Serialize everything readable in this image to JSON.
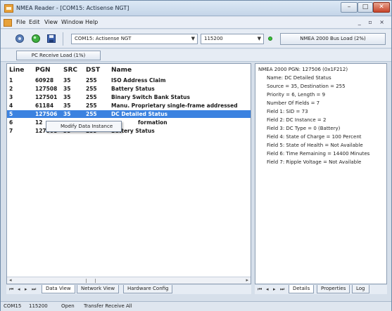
{
  "window": {
    "title": "NMEA Reader - [COM15: Actisense NGT]",
    "title_short": "NMEA Reader - [COM15: Actisense NGT]"
  },
  "menu": {
    "items": [
      "File",
      "Edit",
      "View",
      "Window",
      "Help"
    ],
    "mdi_controls": "_ ▫ ×"
  },
  "toolbar": {
    "port_value": "COM15: Actisense NGT",
    "baud_value": "115200",
    "bus_load_label": "NMEA 2000 Bus Load (2%)",
    "pc_load_label": "PC Receive Load (1%)"
  },
  "list": {
    "headers": {
      "line": "Line",
      "pgn": "PGN",
      "src": "SRC",
      "dst": "DST",
      "name": "Name"
    },
    "rows": [
      {
        "line": "1",
        "pgn": "60928",
        "src": "35",
        "dst": "255",
        "name": "ISO Address Claim"
      },
      {
        "line": "2",
        "pgn": "127508",
        "src": "35",
        "dst": "255",
        "name": "Battery Status"
      },
      {
        "line": "3",
        "pgn": "127501",
        "src": "35",
        "dst": "255",
        "name": "Binary Switch Bank Status"
      },
      {
        "line": "4",
        "pgn": "61184",
        "src": "35",
        "dst": "255",
        "name": "Manu. Proprietary single-frame addressed"
      },
      {
        "line": "5",
        "pgn": "127506",
        "src": "35",
        "dst": "255",
        "name": "DC Detailed Status"
      },
      {
        "line": "6",
        "pgn": "12",
        "src": "",
        "dst": "",
        "name": "formation"
      },
      {
        "line": "7",
        "pgn": "127508",
        "src": "35",
        "dst": "255",
        "name": "Battery Status"
      }
    ],
    "selected_index": 4
  },
  "context_menu": {
    "item": "Modify Data Instance"
  },
  "tabs_left": [
    "Data View",
    "Network View",
    "Hardware Config"
  ],
  "tabs_right": [
    "Details",
    "Properties",
    "Log"
  ],
  "details": {
    "header": "NMEA 2000 PGN: 127506 (0x1F212)",
    "lines": [
      "Name: DC Detailed Status",
      "Source = 35, Destination = 255",
      "Priority = 6, Length = 9",
      "Number Of Fields = 7",
      "Field 1: SID = 73",
      "Field 2: DC Instance = 2",
      "Field 3: DC Type = 0 (Battery)",
      "Field 4: State of Charge = 100 Percent",
      "Field 5: State of Health = Not Available",
      "Field 6: Time Remaining = 14400 Minutes",
      "Field 7: Ripple Voltage = Not Available"
    ]
  },
  "statusbar": {
    "port": "COM15",
    "baud": "115200",
    "state": "Open",
    "mode": "Transfer Receive All"
  },
  "colors": {
    "selection": "#3b82e0",
    "led": "#3ac43a"
  }
}
